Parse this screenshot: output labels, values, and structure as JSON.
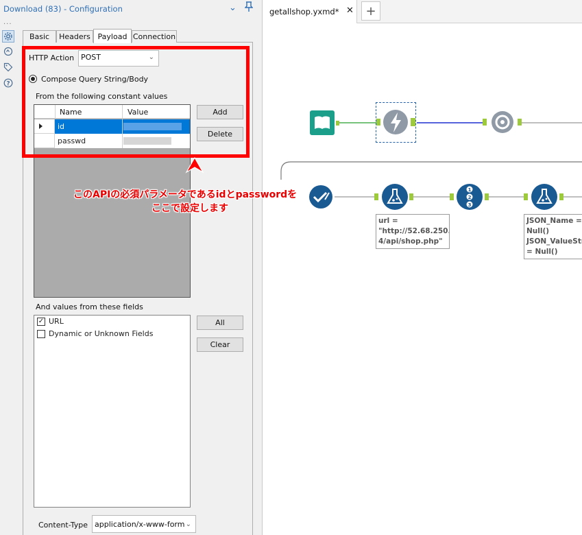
{
  "panel": {
    "title": "Download (83) - Configuration",
    "tabs": [
      "Basic",
      "Headers",
      "Payload",
      "Connection"
    ],
    "active_tab": "Payload"
  },
  "payload": {
    "http_action_label": "HTTP Action",
    "http_action_value": "POST",
    "compose_label": "Compose Query String/Body",
    "constant_values_label": "From the following constant values",
    "columns": [
      "Name",
      "Value"
    ],
    "rows": [
      {
        "name": "id",
        "selected": true
      },
      {
        "name": "passwd",
        "selected": false
      }
    ],
    "add_button": "Add",
    "delete_button": "Delete",
    "fields_label": "And values from these fields",
    "fields": [
      {
        "label": "URL",
        "checked": true
      },
      {
        "label": "Dynamic or Unknown Fields",
        "checked": false
      }
    ],
    "all_button": "All",
    "clear_button": "Clear",
    "content_type_label": "Content-Type",
    "content_type_value": "application/x-www-form"
  },
  "annotation": {
    "line1": "このAPIの必須パラメータであるidとpasswordを",
    "line2": "ここで設定します",
    "color": "#ff0000"
  },
  "canvas": {
    "tab_label": "getallshop.yxmd*",
    "note1": "url =\n\"http://52.68.250.\n4/api/shop.php\"",
    "note2": "JSON_Name =\nNull()\nJSON_ValueStrin\n= Null()",
    "counter_digits": [
      "1",
      "2",
      "3"
    ]
  },
  "colors": {
    "tool_blue": "#1a5a93",
    "tool_teal": "#1b9e8a",
    "connector_green": "#4caf50",
    "connector_blue": "#1f2fcf",
    "selection_blue": "#0078d7"
  }
}
